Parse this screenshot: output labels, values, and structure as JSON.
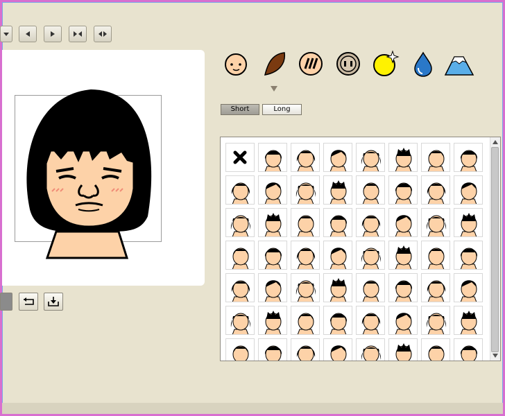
{
  "toolbar": {
    "buttons": [
      "partial-button",
      "prev-button",
      "next-button",
      "flip-vertical-button",
      "flip-horizontal-button"
    ]
  },
  "categories": {
    "items": [
      {
        "name": "face"
      },
      {
        "name": "hair"
      },
      {
        "name": "eyes"
      },
      {
        "name": "nose"
      },
      {
        "name": "accessory"
      },
      {
        "name": "drop"
      },
      {
        "name": "background"
      }
    ],
    "selected": "hair"
  },
  "hair_tabs": {
    "short_label": "Short",
    "long_label": "Long",
    "selected": "Short"
  },
  "hair_grid": {
    "rows": 7,
    "columns": 8,
    "first_cell": "none"
  },
  "colors": {
    "skin": "#fdd2a8",
    "hair": "#000000",
    "panel_bg": "#e8e3cf"
  }
}
